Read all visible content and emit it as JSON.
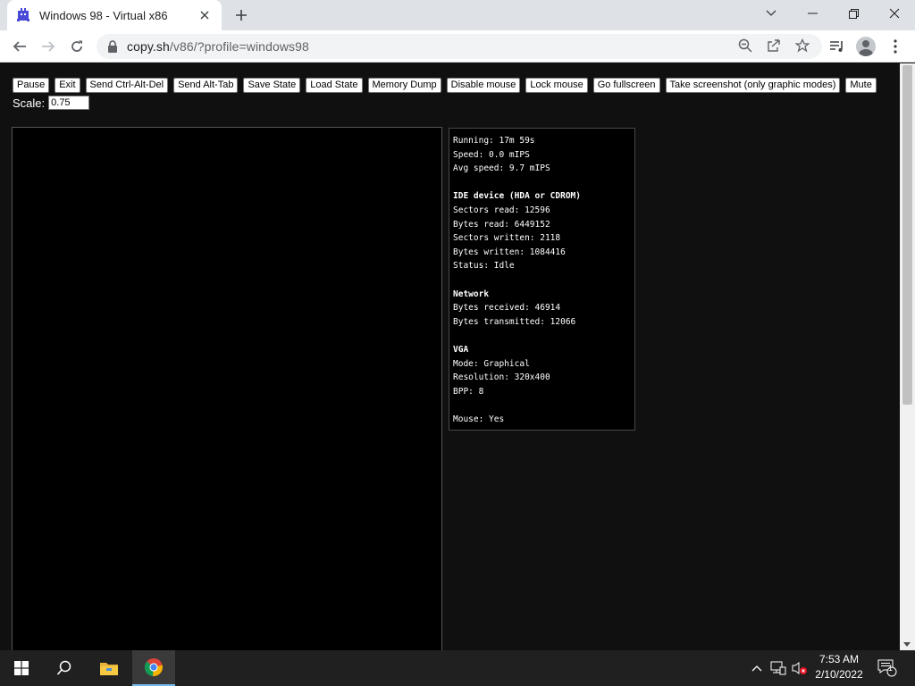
{
  "browser": {
    "tab_title": "Windows 98 - Virtual x86",
    "url_host": "copy.sh",
    "url_path": "/v86/?profile=windows98"
  },
  "page": {
    "buttons": [
      "Pause",
      "Exit",
      "Send Ctrl-Alt-Del",
      "Send Alt-Tab",
      "Save State",
      "Load State",
      "Memory Dump",
      "Disable mouse",
      "Lock mouse",
      "Go fullscreen",
      "Take screenshot (only graphic modes)",
      "Mute"
    ],
    "scale_label": "Scale:",
    "scale_value": "0.75",
    "info": {
      "running": "Running: 17m 59s",
      "speed": "Speed: 0.0 mIPS",
      "avg_speed": "Avg speed: 9.7 mIPS",
      "ide_heading": "IDE device (HDA or CDROM)",
      "sectors_read": "Sectors read: 12596",
      "bytes_read": "Bytes read: 6449152",
      "sectors_written": "Sectors written: 2118",
      "bytes_written": "Bytes written: 1084416",
      "status": "Status: Idle",
      "network_heading": "Network",
      "bytes_received": "Bytes received: 46914",
      "bytes_transmitted": "Bytes transmitted: 12066",
      "vga_heading": "VGA",
      "mode": "Mode: Graphical",
      "resolution": "Resolution: 320x400",
      "bpp": "BPP: 8",
      "mouse": "Mouse: Yes"
    }
  },
  "taskbar": {
    "time": "7:53 AM",
    "date": "2/10/2022",
    "notification_count": "1"
  },
  "icons": [
    "v86-favicon",
    "close-icon",
    "plus-icon",
    "minimize-icon",
    "maximize-icon",
    "window-close-icon",
    "back-arrow-icon",
    "forward-arrow-icon",
    "reload-icon",
    "lock-icon",
    "zoom-out-icon",
    "share-icon",
    "star-icon",
    "media-queue-icon",
    "profile-icon",
    "kebab-menu-icon",
    "windows-start-icon",
    "search-icon",
    "file-explorer-icon",
    "chrome-icon",
    "chevron-up-icon",
    "network-icon",
    "volume-muted-icon",
    "action-center-icon"
  ],
  "colors": {
    "page_background": "#101010",
    "taskbar": "#202020",
    "taskbar_active_indicator": "#76b9ed"
  }
}
